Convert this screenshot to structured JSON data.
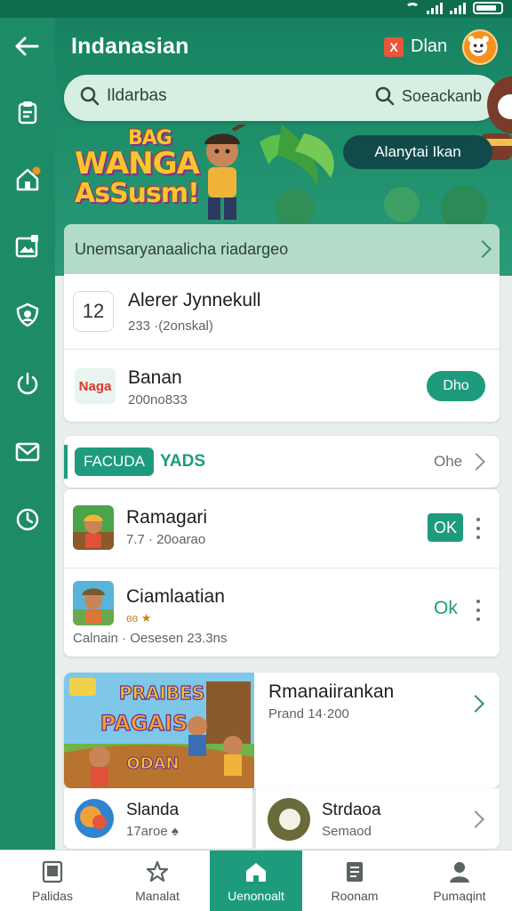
{
  "status_bar": {
    "icons": [
      "wifi-icon",
      "signal-icon",
      "battery-icon"
    ]
  },
  "header": {
    "title": "Indanasian",
    "link_label": "Dlan",
    "flag_glyph": "X"
  },
  "search": {
    "left_placeholder": "Ildarbas",
    "right_label": "Soeackanb"
  },
  "banner": {
    "title_line1": "WANGA",
    "title_line2": "AsSusm!",
    "title_small": "BAG",
    "button_label": "Alanytai Ikan"
  },
  "notice": {
    "text": "Unemsaryanaalicha riadargeo"
  },
  "top_list": [
    {
      "thumb": "12",
      "title": "Alerer Jynnekull",
      "subtitle": "233 ·(2onskal)"
    },
    {
      "thumb": "Naga",
      "title": "Banan",
      "subtitle": "200no833",
      "button": "Dho"
    }
  ],
  "section": {
    "tag": "FACUDA",
    "title": "YADS",
    "see_all": "Ohe"
  },
  "game_list": [
    {
      "title": "Ramagari",
      "subtitle": "7.7 · 20oarao",
      "action": "OK",
      "action_style": "filled"
    },
    {
      "title": "Ciamlaatian",
      "subtitle": "Calnain · Oesesen 23.3ns",
      "rating_text": "ɞɞ ★",
      "action": "Ok",
      "action_style": "text"
    }
  ],
  "featured": {
    "art_text_1": "PRAIBES",
    "art_text_2": "PAGAIS",
    "art_text_3": "ODAN",
    "title": "Rmanaiirankan",
    "subtitle": "Prand 14·200"
  },
  "mini_cards": [
    {
      "title": "Slanda",
      "subtitle": "17aroe ♠"
    },
    {
      "title": "Strdaoa",
      "subtitle": "Semaod"
    }
  ],
  "bottom_nav": [
    {
      "label": "Palidas",
      "icon": "tablet-icon",
      "active": false
    },
    {
      "label": "Manalat",
      "icon": "star-icon",
      "active": false
    },
    {
      "label": "Uenonoalt",
      "icon": "home-icon",
      "active": true
    },
    {
      "label": "Roonam",
      "icon": "document-icon",
      "active": false
    },
    {
      "label": "Pumaqint",
      "icon": "profile-icon",
      "active": false
    }
  ],
  "sidebar_icons": [
    "clipboard-icon",
    "home-badge-icon",
    "image-gallery-icon",
    "shield-icon",
    "power-icon",
    "mail-icon",
    "history-icon"
  ],
  "colors": {
    "primary": "#1e9b7c",
    "header_green": "#16805f",
    "accent_orange": "#f5921e"
  }
}
